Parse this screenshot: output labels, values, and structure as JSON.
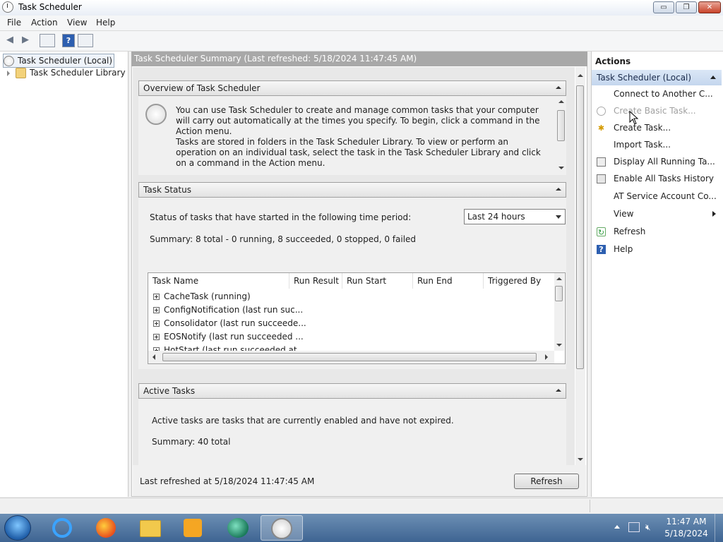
{
  "window": {
    "title": "Task Scheduler",
    "btn_min": "▭",
    "btn_max": "❐",
    "btn_close": "✕"
  },
  "menu": [
    "File",
    "Action",
    "View",
    "Help"
  ],
  "tree": {
    "root": "Task Scheduler (Local)",
    "child": "Task Scheduler Library"
  },
  "center": {
    "header": "Task Scheduler Summary (Last refreshed: 5/18/2024 11:47:45 AM)",
    "overview": {
      "title": "Overview of Task Scheduler",
      "p1": "You can use Task Scheduler to create and manage common tasks that your computer will carry out automatically at the times you specify. To begin, click a command in the Action menu.",
      "p2": "Tasks are stored in folders in the Task Scheduler Library. To view or perform an operation on an individual task, select the task in the Task Scheduler Library and click on a command in the Action menu."
    },
    "status": {
      "title": "Task Status",
      "period_label": "Status of tasks that have started in the following time period:",
      "period_value": "Last 24 hours",
      "summary": "Summary: 8 total - 0 running, 8 succeeded, 0 stopped, 0 failed",
      "columns": [
        "Task Name",
        "Run Result",
        "Run Start",
        "Run End",
        "Triggered By"
      ],
      "rows": [
        "CacheTask (running)",
        "ConfigNotification (last run suc...",
        "Consolidator (last run succeede...",
        "EOSNotify (last run succeeded ...",
        "HotStart (last run succeeded at..."
      ]
    },
    "active": {
      "title": "Active Tasks",
      "desc": "Active tasks are tasks that are currently enabled and have not expired.",
      "summary": "Summary: 40 total"
    },
    "last_refreshed": "Last refreshed at 5/18/2024 11:47:45 AM",
    "refresh_button": "Refresh"
  },
  "actions": {
    "header": "Actions",
    "section": "Task Scheduler (Local)",
    "items": [
      "Connect to Another C...",
      "Create Basic Task...",
      "Create Task...",
      "Import Task...",
      "Display All Running Ta...",
      "Enable All Tasks History",
      "AT Service Account Co...",
      "View",
      "Refresh",
      "Help"
    ]
  },
  "tray": {
    "time": "11:47 AM",
    "date": "5/18/2024"
  },
  "colors": {
    "accent": "#3e6492",
    "selection": "#c4d6ee",
    "center_header": "#a8a8a8"
  }
}
